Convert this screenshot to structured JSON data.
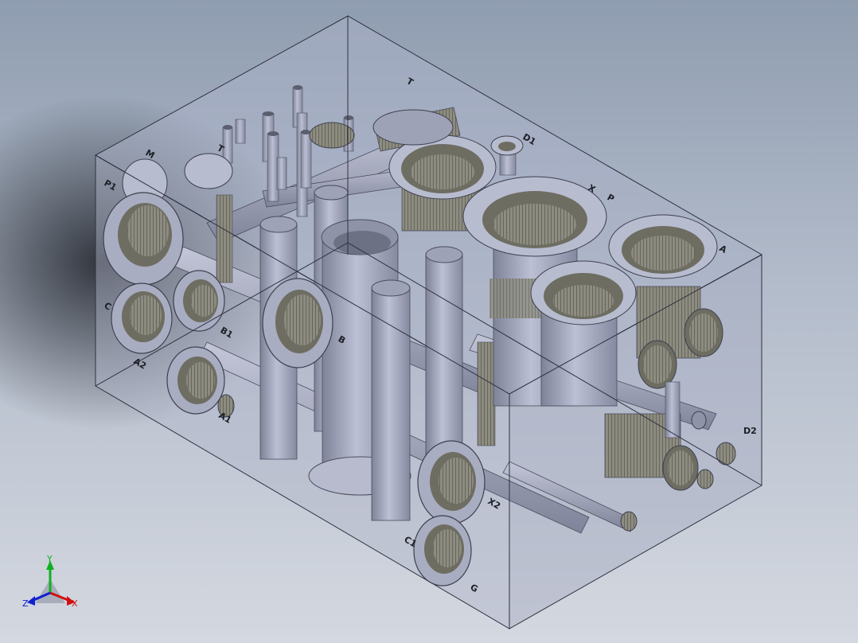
{
  "viewport": {
    "port_labels": [
      "P1",
      "M",
      "T",
      "T",
      "D1",
      "X",
      "P",
      "A",
      "B",
      "A2",
      "B1",
      "A1",
      "X2",
      "D2",
      "C",
      "C1",
      "G"
    ]
  },
  "triad": {
    "x_label": "X",
    "y_label": "Y",
    "z_label": "Z",
    "x_color": "#d01010",
    "y_color": "#10b020",
    "z_color": "#1020d0"
  }
}
